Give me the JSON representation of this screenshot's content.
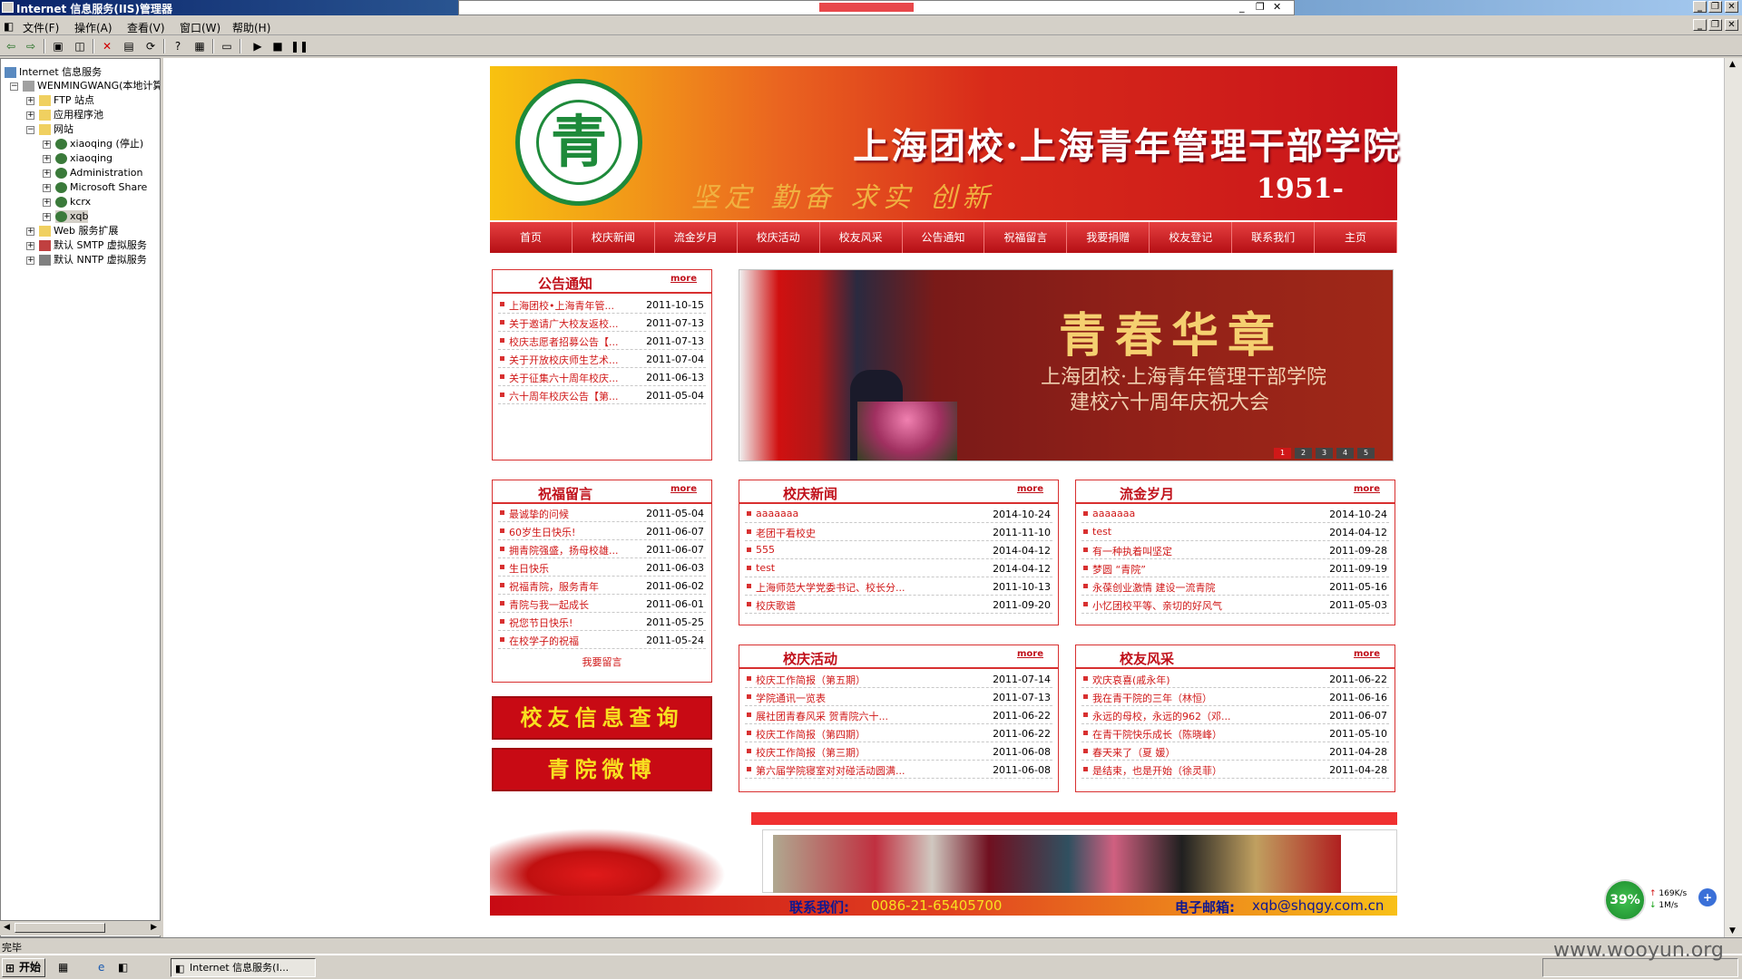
{
  "window": {
    "title": "Internet 信息服务(IIS)管理器",
    "ie_title": ""
  },
  "menu": [
    "文件(F)",
    "操作(A)",
    "查看(V)",
    "窗口(W)",
    "帮助(H)"
  ],
  "tree": {
    "root": "Internet 信息服务",
    "computer": "WENMINGWANG(本地计算机)",
    "ftp": "FTP 站点",
    "apppool": "应用程序池",
    "websites": "网站",
    "sites": [
      "xiaoqing (停止)",
      "xiaoqing",
      "Administration",
      "Microsoft Share",
      "kcrx",
      "xqb"
    ],
    "webext": "Web 服务扩展",
    "smtp": "默认 SMTP 虚拟服务",
    "nntp": "默认 NNTP 虚拟服务"
  },
  "banner": {
    "title": "上海团校·上海青年管理干部学院",
    "slogan": "坚定 勤奋 求实 创新",
    "year": "1951-",
    "logo_char": "青"
  },
  "nav": [
    "首页",
    "校庆新闻",
    "流金岁月",
    "校庆活动",
    "校友风采",
    "公告通知",
    "祝福留言",
    "我要捐赠",
    "校友登记",
    "联系我们",
    "主页"
  ],
  "notice": {
    "title": "公告通知",
    "more": "more",
    "items": [
      {
        "t": "上海团校•上海青年管...",
        "d": "2011-10-15"
      },
      {
        "t": "关于邀请广大校友返校...",
        "d": "2011-07-13"
      },
      {
        "t": "校庆志愿者招募公告【...",
        "d": "2011-07-13"
      },
      {
        "t": "关于开放校庆师生艺术...",
        "d": "2011-07-04"
      },
      {
        "t": "关于征集六十周年校庆...",
        "d": "2011-06-13"
      },
      {
        "t": "六十周年校庆公告【第...",
        "d": "2011-05-04"
      }
    ]
  },
  "slide": {
    "title": "青春华章",
    "sub1": "上海团校·上海青年管理干部学院",
    "sub2": "建校六十周年庆祝大会",
    "dots": [
      "1",
      "2",
      "3",
      "4",
      "5"
    ]
  },
  "blessing": {
    "title": "祝福留言",
    "more": "more",
    "footer": "我要留言",
    "items": [
      {
        "t": "最诚挚的问候",
        "d": "2011-05-04"
      },
      {
        "t": "60岁生日快乐!",
        "d": "2011-06-07"
      },
      {
        "t": "拥青院强盛，扬母校雄...",
        "d": "2011-06-07"
      },
      {
        "t": "生日快乐",
        "d": "2011-06-03"
      },
      {
        "t": "祝福青院，服务青年",
        "d": "2011-06-02"
      },
      {
        "t": "青院与我一起成长",
        "d": "2011-06-01"
      },
      {
        "t": "祝您节日快乐!",
        "d": "2011-05-25"
      },
      {
        "t": "在校学子的祝福",
        "d": "2011-05-24"
      }
    ]
  },
  "news": {
    "title": "校庆新闻",
    "more": "more",
    "items": [
      {
        "t": "aaaaaaa",
        "d": "2014-10-24"
      },
      {
        "t": "老团干看校史",
        "d": "2011-11-10"
      },
      {
        "t": "555",
        "d": "2014-04-12"
      },
      {
        "t": "test",
        "d": "2014-04-12"
      },
      {
        "t": "上海师范大学党委书记、校长分...",
        "d": "2011-10-13"
      },
      {
        "t": "校庆歌谱",
        "d": "2011-09-20"
      }
    ]
  },
  "years": {
    "title": "流金岁月",
    "more": "more",
    "items": [
      {
        "t": "aaaaaaa",
        "d": "2014-10-24"
      },
      {
        "t": "test",
        "d": "2014-04-12"
      },
      {
        "t": "有一种执着叫坚定",
        "d": "2011-09-28"
      },
      {
        "t": "梦圆 “青院”",
        "d": "2011-09-19"
      },
      {
        "t": "永葆创业激情 建设一流青院",
        "d": "2011-05-16"
      },
      {
        "t": "小忆团校平等、亲切的好风气",
        "d": "2011-05-03"
      }
    ]
  },
  "activities": {
    "title": "校庆活动",
    "more": "more",
    "items": [
      {
        "t": "校庆工作简报（第五期）",
        "d": "2011-07-14"
      },
      {
        "t": "学院通讯一览表",
        "d": "2011-07-13"
      },
      {
        "t": "展社团青春风采 贺青院六十...",
        "d": "2011-06-22"
      },
      {
        "t": "校庆工作简报（第四期）",
        "d": "2011-06-22"
      },
      {
        "t": "校庆工作简报（第三期）",
        "d": "2011-06-08"
      },
      {
        "t": "第六届学院寝室对对碰活动圆满...",
        "d": "2011-06-08"
      }
    ]
  },
  "alumni": {
    "title": "校友风采",
    "more": "more",
    "items": [
      {
        "t": "欢庆哀喜(戚永年)",
        "d": "2011-06-22"
      },
      {
        "t": "我在青干院的三年（林恒）",
        "d": "2011-06-16"
      },
      {
        "t": "永远的母校，永远的962（邓...",
        "d": "2011-06-07"
      },
      {
        "t": "在青干院快乐成长（陈晓峰）",
        "d": "2011-05-10"
      },
      {
        "t": "春天来了（夏 媛）",
        "d": "2011-04-28"
      },
      {
        "t": "是结束，也是开始（徐灵菲）",
        "d": "2011-04-28"
      }
    ]
  },
  "buttons": {
    "alumni_query": "校友信息查询",
    "weibo": "青院微博"
  },
  "footer": {
    "contact_label": "联系我们:",
    "contact_value": "0086-21-65405700",
    "email_label": "电子邮箱:",
    "email_value": "xqb@shqgy.com.cn"
  },
  "status": {
    "text": "完毕"
  },
  "taskbar": {
    "start": "开始",
    "item": "Internet 信息服务(I..."
  },
  "tray": {
    "percent": "39%",
    "up": "169K/s",
    "down": "1M/s"
  },
  "watermark": "www.wooyun.org",
  "colors": {
    "accent": "#d83030",
    "nav": "#c8141a",
    "titlebar": "#0a246a"
  }
}
